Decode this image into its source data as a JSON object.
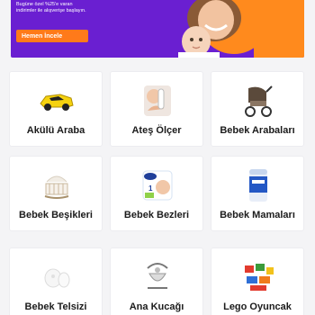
{
  "banner": {
    "line1": "Bugüne özel %25'e varan",
    "line2": "indirimler ile alışverişe başlayın.",
    "cta_label": "Hemen İncele"
  },
  "categories": [
    {
      "label": "Akülü Araba",
      "icon": "toy-car-icon"
    },
    {
      "label": "Ateş Ölçer",
      "icon": "thermometer-icon"
    },
    {
      "label": "Bebek Arabaları",
      "icon": "stroller-icon"
    },
    {
      "label": "Bebek Beşikleri",
      "icon": "crib-icon"
    },
    {
      "label": "Bebek Bezleri",
      "icon": "diaper-pack-icon"
    },
    {
      "label": "Bebek Mamaları",
      "icon": "formula-can-icon"
    },
    {
      "label": "Bebek Telsizi",
      "icon": "baby-monitor-icon"
    },
    {
      "label": "Ana Kucağı",
      "icon": "bouncer-icon"
    },
    {
      "label": "Lego Oyuncak",
      "icon": "lego-blocks-icon"
    }
  ],
  "colors": {
    "banner_bg": "#6a1fd1",
    "cta_bg": "#ff7a1a",
    "accent_orange": "#ff8a1d"
  }
}
